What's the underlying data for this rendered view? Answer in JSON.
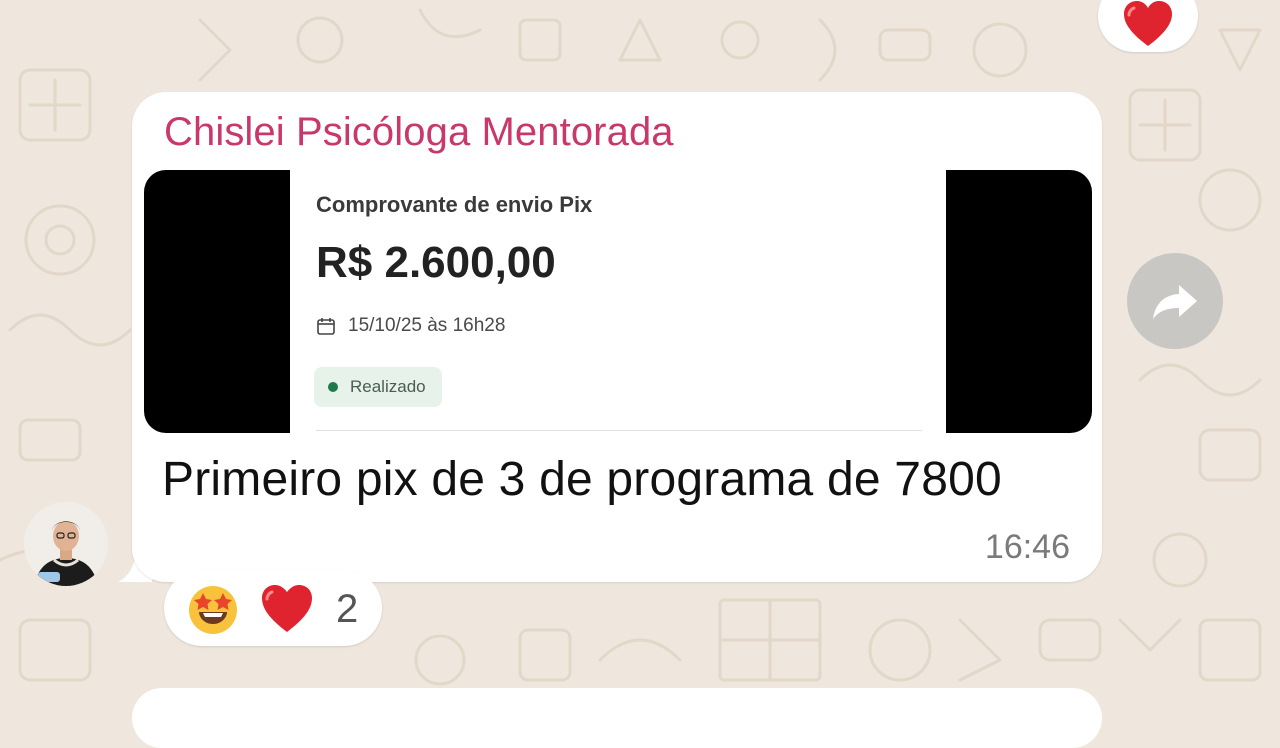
{
  "message": {
    "sender": "Chislei Psicóloga Mentorada",
    "text": "Primeiro pix de 3 de programa de 7800",
    "time": "16:46",
    "sender_color": "#c8386a"
  },
  "receipt": {
    "title": "Comprovante de envio Pix",
    "amount": "R$ 2.600,00",
    "date": "15/10/25 às 16h28",
    "status": "Realizado",
    "status_color": "#1f7a49"
  },
  "reactions": {
    "emojis": [
      "star-struck-icon",
      "red-heart-icon"
    ],
    "count": "2"
  },
  "top_reaction": {
    "emoji": "red-heart-icon"
  },
  "icons": {
    "forward": "forward-arrow-icon",
    "calendar": "calendar-icon",
    "avatar": "user-avatar"
  },
  "colors": {
    "chat_background": "#efe7dd",
    "bubble": "#ffffff",
    "heart": "#e0242f"
  }
}
